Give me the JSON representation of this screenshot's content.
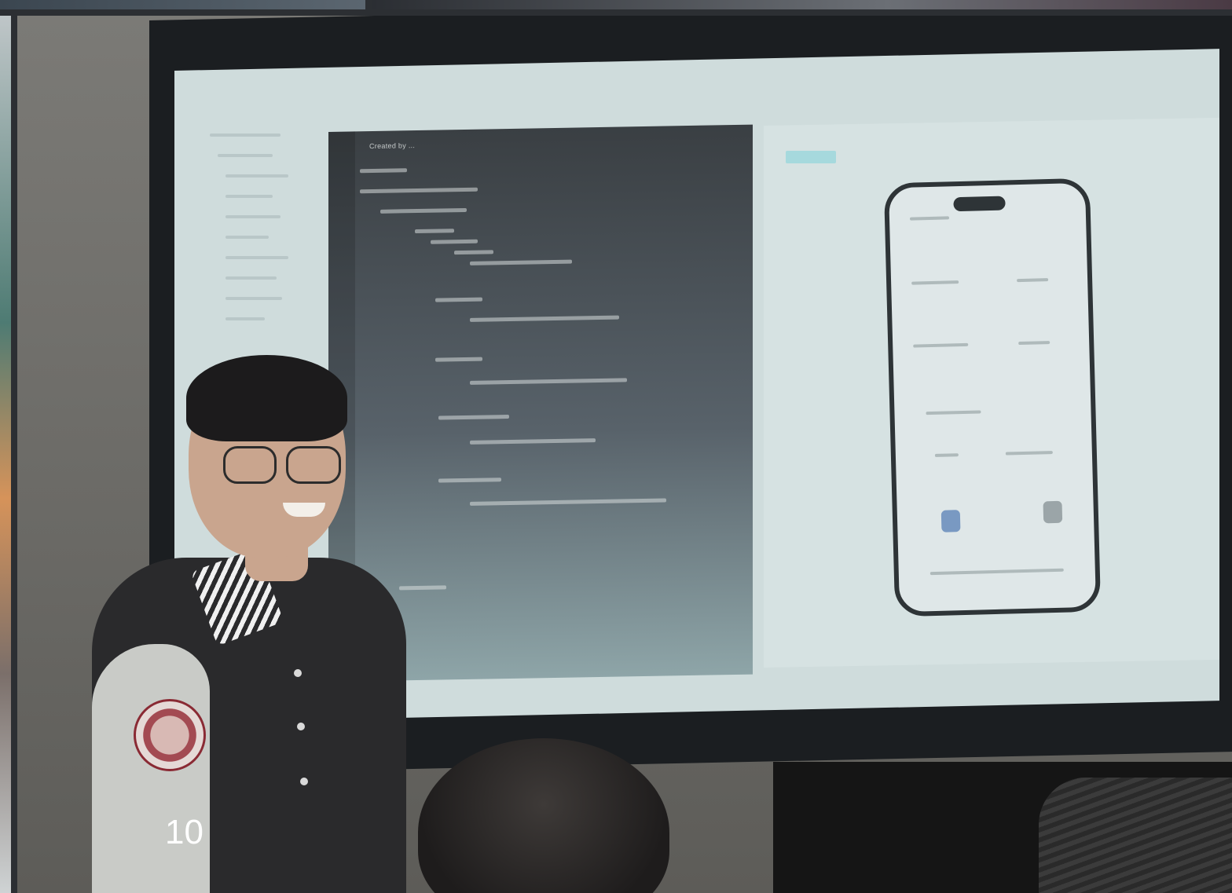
{
  "slide": {
    "page_number": "10"
  },
  "screen": {
    "code_comment": "Created by ..."
  },
  "colors": {
    "ide_background": "#cfdcdc",
    "code_panel": "#3a3f43",
    "accent_teal": "#7fd2d8",
    "jacket_body": "#2a2a2c",
    "jacket_sleeve": "#c9cbc7"
  }
}
